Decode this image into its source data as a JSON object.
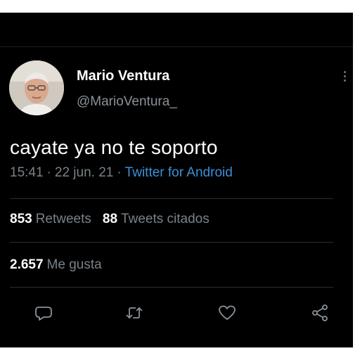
{
  "user": {
    "display_name": "Mario Ventura",
    "handle": "@MarioVentura_",
    "avatar_icon": "profile-photo"
  },
  "tweet": {
    "text": "cayate ya no te soporto",
    "time": "15:41",
    "separator": "·",
    "date": "22 jun. 21",
    "source": "Twitter for Android"
  },
  "stats": {
    "retweets_count": "853",
    "retweets_label": "Retweets",
    "quotes_count": "88",
    "quotes_label": "Tweets citados",
    "likes_count": "2.657",
    "likes_label": "Me gusta"
  },
  "actions": [
    {
      "icon": "reply-icon"
    },
    {
      "icon": "retweet-icon"
    },
    {
      "icon": "heart-icon"
    },
    {
      "icon": "share-icon"
    }
  ],
  "colors": {
    "background": "#000000",
    "primary_text": "#ffffff",
    "secondary_text": "#7a8288",
    "link": "#3d8fd6"
  }
}
